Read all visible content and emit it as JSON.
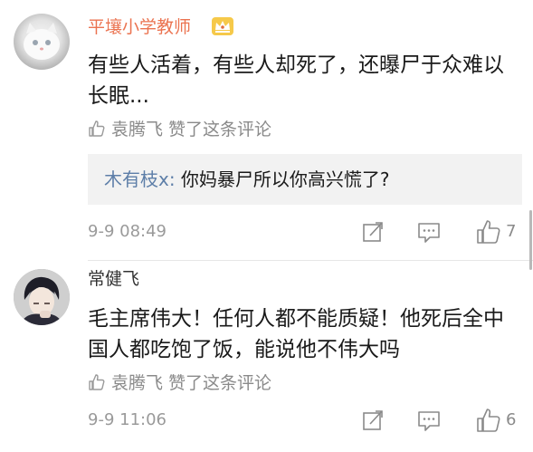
{
  "comments": [
    {
      "author": "平壤小学教师",
      "badge_icon": "crown-icon",
      "text": "有些人活着，有些人却死了，还曝尸于众难以长眠...",
      "liked_by": "袁腾飞 赞了这条评论",
      "reply": {
        "name": "木有枝x:",
        "text": " 你妈暴尸所以你高兴慌了?"
      },
      "time": "9-9 08:49",
      "like_count": "7"
    },
    {
      "author": "常健飞",
      "text": "毛主席伟大！任何人都不能质疑！他死后全中国人都吃饱了饭，能说他不伟大吗",
      "liked_by": "袁腾飞 赞了这条评论",
      "time": "9-9 11:06",
      "like_count": "6"
    }
  ],
  "colors": {
    "author_highlight": "#eb7350",
    "reply_name": "#5d7ea8",
    "meta_gray": "#8a8a8a",
    "reply_bg": "#f2f2f2"
  }
}
